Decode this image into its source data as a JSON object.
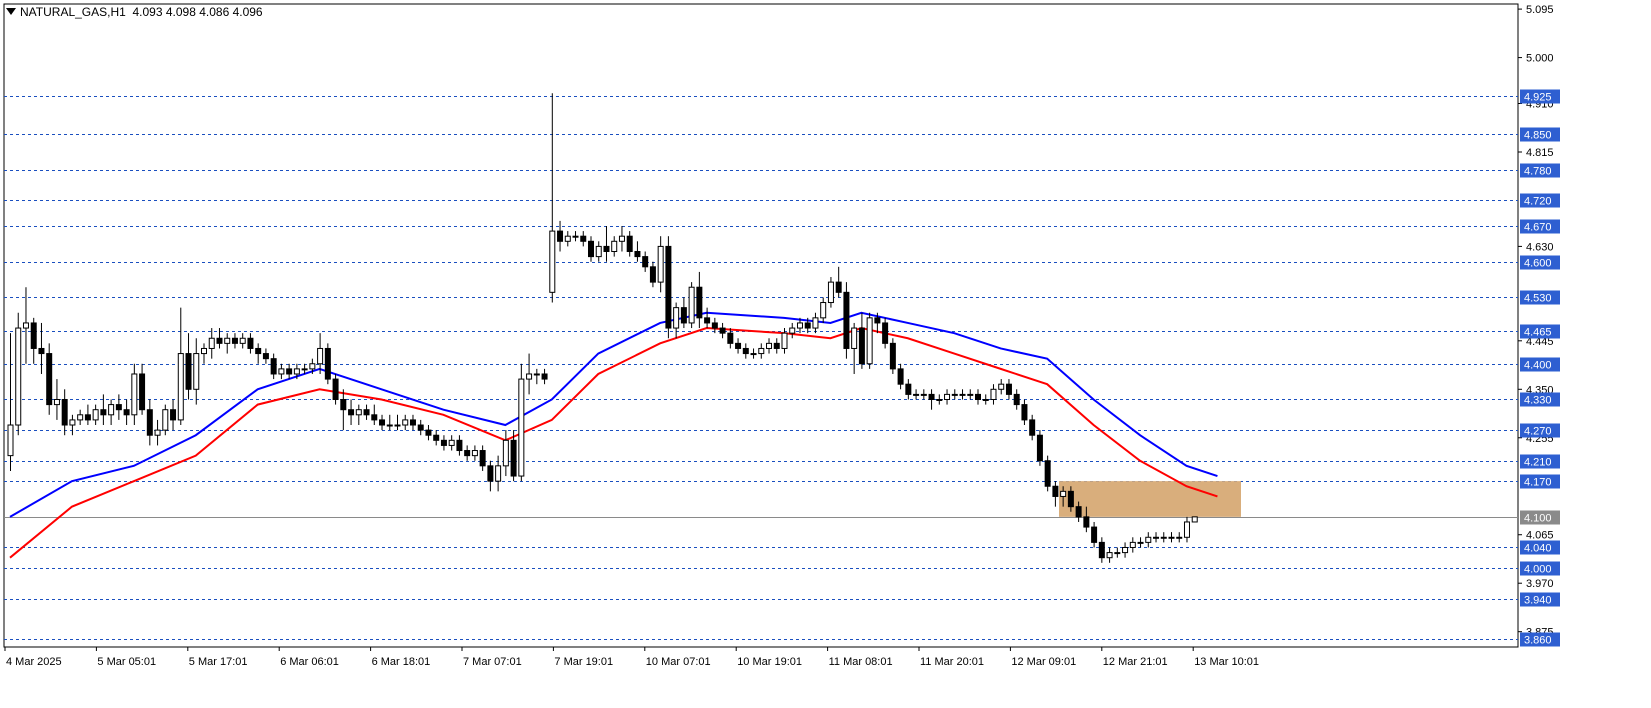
{
  "header": {
    "symbol_label": "NATURAL_GAS,H1",
    "ohlc_label": "4.093 4.098 4.086 4.096"
  },
  "colors": {
    "up_candle": "#ffffff",
    "down_candle": "#000000",
    "fast_ma": "#0000ff",
    "slow_ma": "#ff0000",
    "level_line": "#1a4fbf",
    "zone_fill": "#d9ae7c",
    "price_tag_bg": "#2e5fd1"
  },
  "chart_data": {
    "type": "candlestick",
    "ylim": [
      3.845,
      5.105
    ],
    "y_axis_ticks": [
      "5.095",
      "5.000",
      "4.910",
      "4.815",
      "4.630",
      "4.445",
      "4.350",
      "4.255",
      "4.065",
      "3.970",
      "3.875"
    ],
    "level_lines": [
      "4.925",
      "4.850",
      "4.780",
      "4.720",
      "4.670",
      "4.600",
      "4.530",
      "4.465",
      "4.400",
      "4.330",
      "4.270",
      "4.210",
      "4.170",
      "4.100",
      "4.040",
      "4.000",
      "3.940",
      "3.860"
    ],
    "x_axis_labels": [
      "4 Mar 2025",
      "5 Mar 05:01",
      "5 Mar 17:01",
      "6 Mar 06:01",
      "6 Mar 18:01",
      "7 Mar 07:01",
      "7 Mar 19:01",
      "10 Mar 07:01",
      "10 Mar 19:01",
      "11 Mar 08:01",
      "11 Mar 20:01",
      "12 Mar 09:01",
      "12 Mar 21:01",
      "13 Mar 10:01"
    ],
    "zone": {
      "low": 4.1,
      "high": 4.17
    },
    "candles": [
      [
        4.22,
        4.46,
        4.19,
        4.28
      ],
      [
        4.28,
        4.5,
        4.26,
        4.47
      ],
      [
        4.47,
        4.55,
        4.4,
        4.48
      ],
      [
        4.48,
        4.49,
        4.4,
        4.43
      ],
      [
        4.43,
        4.48,
        4.38,
        4.42
      ],
      [
        4.42,
        4.44,
        4.3,
        4.32
      ],
      [
        4.32,
        4.37,
        4.29,
        4.33
      ],
      [
        4.33,
        4.35,
        4.26,
        4.28
      ],
      [
        4.28,
        4.3,
        4.26,
        4.29
      ],
      [
        4.29,
        4.31,
        4.28,
        4.3
      ],
      [
        4.3,
        4.32,
        4.28,
        4.29
      ],
      [
        4.29,
        4.32,
        4.28,
        4.31
      ],
      [
        4.31,
        4.34,
        4.28,
        4.3
      ],
      [
        4.3,
        4.33,
        4.28,
        4.32
      ],
      [
        4.32,
        4.34,
        4.29,
        4.31
      ],
      [
        4.31,
        4.33,
        4.28,
        4.3
      ],
      [
        4.3,
        4.4,
        4.28,
        4.38
      ],
      [
        4.38,
        4.4,
        4.3,
        4.31
      ],
      [
        4.31,
        4.33,
        4.24,
        4.26
      ],
      [
        4.26,
        4.29,
        4.24,
        4.27
      ],
      [
        4.27,
        4.32,
        4.26,
        4.31
      ],
      [
        4.31,
        4.33,
        4.27,
        4.29
      ],
      [
        4.29,
        4.51,
        4.28,
        4.42
      ],
      [
        4.42,
        4.46,
        4.33,
        4.35
      ],
      [
        4.35,
        4.45,
        4.32,
        4.42
      ],
      [
        4.42,
        4.44,
        4.4,
        4.43
      ],
      [
        4.43,
        4.47,
        4.41,
        4.45
      ],
      [
        4.45,
        4.47,
        4.43,
        4.44
      ],
      [
        4.44,
        4.46,
        4.42,
        4.45
      ],
      [
        4.45,
        4.46,
        4.43,
        4.44
      ],
      [
        4.44,
        4.46,
        4.43,
        4.45
      ],
      [
        4.45,
        4.46,
        4.42,
        4.43
      ],
      [
        4.43,
        4.44,
        4.4,
        4.42
      ],
      [
        4.42,
        4.43,
        4.4,
        4.41
      ],
      [
        4.41,
        4.42,
        4.37,
        4.38
      ],
      [
        4.38,
        4.4,
        4.37,
        4.39
      ],
      [
        4.39,
        4.4,
        4.37,
        4.38
      ],
      [
        4.38,
        4.4,
        4.37,
        4.39
      ],
      [
        4.39,
        4.4,
        4.38,
        4.39
      ],
      [
        4.39,
        4.41,
        4.38,
        4.4
      ],
      [
        4.4,
        4.46,
        4.38,
        4.43
      ],
      [
        4.43,
        4.44,
        4.36,
        4.37
      ],
      [
        4.37,
        4.38,
        4.32,
        4.33
      ],
      [
        4.33,
        4.35,
        4.27,
        4.31
      ],
      [
        4.31,
        4.33,
        4.28,
        4.3
      ],
      [
        4.3,
        4.32,
        4.28,
        4.31
      ],
      [
        4.31,
        4.32,
        4.29,
        4.3
      ],
      [
        4.3,
        4.32,
        4.28,
        4.29
      ],
      [
        4.29,
        4.3,
        4.27,
        4.28
      ],
      [
        4.28,
        4.3,
        4.27,
        4.28
      ],
      [
        4.28,
        4.3,
        4.27,
        4.28
      ],
      [
        4.28,
        4.3,
        4.27,
        4.29
      ],
      [
        4.29,
        4.3,
        4.27,
        4.28
      ],
      [
        4.28,
        4.29,
        4.26,
        4.27
      ],
      [
        4.27,
        4.28,
        4.25,
        4.26
      ],
      [
        4.26,
        4.27,
        4.24,
        4.25
      ],
      [
        4.25,
        4.26,
        4.23,
        4.24
      ],
      [
        4.24,
        4.26,
        4.23,
        4.25
      ],
      [
        4.25,
        4.26,
        4.22,
        4.23
      ],
      [
        4.23,
        4.24,
        4.21,
        4.22
      ],
      [
        4.22,
        4.24,
        4.21,
        4.23
      ],
      [
        4.23,
        4.24,
        4.19,
        4.2
      ],
      [
        4.2,
        4.21,
        4.15,
        4.17
      ],
      [
        4.17,
        4.22,
        4.15,
        4.2
      ],
      [
        4.2,
        4.27,
        4.18,
        4.25
      ],
      [
        4.25,
        4.27,
        4.17,
        4.18
      ],
      [
        4.18,
        4.4,
        4.17,
        4.37
      ],
      [
        4.37,
        4.42,
        4.34,
        4.38
      ],
      [
        4.38,
        4.39,
        4.36,
        4.38
      ],
      [
        4.38,
        4.39,
        4.36,
        4.37
      ],
      [
        4.54,
        4.93,
        4.52,
        4.66
      ],
      [
        4.66,
        4.68,
        4.62,
        4.64
      ],
      [
        4.64,
        4.66,
        4.63,
        4.65
      ],
      [
        4.65,
        4.66,
        4.64,
        4.65
      ],
      [
        4.65,
        4.66,
        4.63,
        4.64
      ],
      [
        4.64,
        4.65,
        4.6,
        4.61
      ],
      [
        4.61,
        4.64,
        4.6,
        4.63
      ],
      [
        4.63,
        4.67,
        4.6,
        4.62
      ],
      [
        4.62,
        4.65,
        4.61,
        4.64
      ],
      [
        4.64,
        4.67,
        4.62,
        4.65
      ],
      [
        4.65,
        4.66,
        4.61,
        4.62
      ],
      [
        4.62,
        4.64,
        4.6,
        4.61
      ],
      [
        4.61,
        4.62,
        4.58,
        4.59
      ],
      [
        4.59,
        4.6,
        4.55,
        4.56
      ],
      [
        4.56,
        4.65,
        4.54,
        4.63
      ],
      [
        4.63,
        4.65,
        4.45,
        4.47
      ],
      [
        4.47,
        4.52,
        4.45,
        4.51
      ],
      [
        4.51,
        4.53,
        4.47,
        4.48
      ],
      [
        4.48,
        4.56,
        4.47,
        4.55
      ],
      [
        4.55,
        4.58,
        4.47,
        4.49
      ],
      [
        4.49,
        4.51,
        4.47,
        4.48
      ],
      [
        4.48,
        4.49,
        4.46,
        4.47
      ],
      [
        4.47,
        4.48,
        4.45,
        4.46
      ],
      [
        4.46,
        4.47,
        4.43,
        4.44
      ],
      [
        4.44,
        4.45,
        4.42,
        4.43
      ],
      [
        4.43,
        4.44,
        4.41,
        4.42
      ],
      [
        4.42,
        4.43,
        4.41,
        4.42
      ],
      [
        4.42,
        4.44,
        4.41,
        4.43
      ],
      [
        4.43,
        4.45,
        4.42,
        4.44
      ],
      [
        4.44,
        4.45,
        4.42,
        4.43
      ],
      [
        4.43,
        4.47,
        4.42,
        4.46
      ],
      [
        4.46,
        4.48,
        4.45,
        4.47
      ],
      [
        4.47,
        4.49,
        4.46,
        4.48
      ],
      [
        4.48,
        4.49,
        4.46,
        4.47
      ],
      [
        4.47,
        4.5,
        4.46,
        4.49
      ],
      [
        4.49,
        4.53,
        4.48,
        4.52
      ],
      [
        4.52,
        4.57,
        4.51,
        4.56
      ],
      [
        4.56,
        4.59,
        4.53,
        4.54
      ],
      [
        4.54,
        4.56,
        4.41,
        4.43
      ],
      [
        4.43,
        4.48,
        4.38,
        4.47
      ],
      [
        4.47,
        4.5,
        4.39,
        4.4
      ],
      [
        4.4,
        4.5,
        4.39,
        4.49
      ],
      [
        4.49,
        4.5,
        4.46,
        4.48
      ],
      [
        4.48,
        4.49,
        4.43,
        4.44
      ],
      [
        4.44,
        4.45,
        4.38,
        4.39
      ],
      [
        4.39,
        4.4,
        4.35,
        4.36
      ],
      [
        4.36,
        4.37,
        4.33,
        4.34
      ],
      [
        4.34,
        4.35,
        4.33,
        4.34
      ],
      [
        4.34,
        4.35,
        4.33,
        4.34
      ],
      [
        4.34,
        4.35,
        4.31,
        4.33
      ],
      [
        4.33,
        4.34,
        4.32,
        4.33
      ],
      [
        4.33,
        4.35,
        4.32,
        4.34
      ],
      [
        4.34,
        4.35,
        4.33,
        4.34
      ],
      [
        4.34,
        4.35,
        4.33,
        4.34
      ],
      [
        4.34,
        4.35,
        4.33,
        4.34
      ],
      [
        4.34,
        4.35,
        4.32,
        4.33
      ],
      [
        4.33,
        4.34,
        4.32,
        4.33
      ],
      [
        4.33,
        4.36,
        4.32,
        4.35
      ],
      [
        4.35,
        4.37,
        4.34,
        4.36
      ],
      [
        4.36,
        4.37,
        4.33,
        4.34
      ],
      [
        4.34,
        4.35,
        4.31,
        4.32
      ],
      [
        4.32,
        4.33,
        4.28,
        4.29
      ],
      [
        4.29,
        4.3,
        4.25,
        4.26
      ],
      [
        4.26,
        4.27,
        4.2,
        4.21
      ],
      [
        4.21,
        4.22,
        4.15,
        4.16
      ],
      [
        4.16,
        4.17,
        4.12,
        4.14
      ],
      [
        4.14,
        4.16,
        4.12,
        4.15
      ],
      [
        4.15,
        4.16,
        4.11,
        4.12
      ],
      [
        4.12,
        4.13,
        4.09,
        4.1
      ],
      [
        4.1,
        4.12,
        4.07,
        4.08
      ],
      [
        4.08,
        4.09,
        4.04,
        4.05
      ],
      [
        4.05,
        4.06,
        4.01,
        4.02
      ],
      [
        4.02,
        4.04,
        4.01,
        4.03
      ],
      [
        4.03,
        4.04,
        4.02,
        4.03
      ],
      [
        4.03,
        4.05,
        4.02,
        4.04
      ],
      [
        4.04,
        4.06,
        4.03,
        4.05
      ],
      [
        4.05,
        4.06,
        4.04,
        4.05
      ],
      [
        4.05,
        4.07,
        4.04,
        4.06
      ],
      [
        4.06,
        4.07,
        4.05,
        4.06
      ],
      [
        4.06,
        4.07,
        4.05,
        4.06
      ],
      [
        4.06,
        4.07,
        4.05,
        4.06
      ],
      [
        4.06,
        4.07,
        4.05,
        4.06
      ],
      [
        4.06,
        4.1,
        4.05,
        4.09
      ],
      [
        4.09,
        4.1,
        4.09,
        4.1
      ]
    ],
    "fast_ma": [
      [
        0,
        4.1
      ],
      [
        8,
        4.17
      ],
      [
        16,
        4.2
      ],
      [
        24,
        4.26
      ],
      [
        32,
        4.35
      ],
      [
        40,
        4.39
      ],
      [
        48,
        4.35
      ],
      [
        56,
        4.31
      ],
      [
        64,
        4.28
      ],
      [
        70,
        4.33
      ],
      [
        76,
        4.42
      ],
      [
        84,
        4.48
      ],
      [
        90,
        4.5
      ],
      [
        100,
        4.49
      ],
      [
        106,
        4.48
      ],
      [
        110,
        4.5
      ],
      [
        116,
        4.48
      ],
      [
        122,
        4.46
      ],
      [
        128,
        4.43
      ],
      [
        134,
        4.41
      ],
      [
        140,
        4.33
      ],
      [
        146,
        4.26
      ],
      [
        152,
        4.2
      ],
      [
        156,
        4.18
      ]
    ],
    "slow_ma": [
      [
        0,
        4.02
      ],
      [
        8,
        4.12
      ],
      [
        16,
        4.17
      ],
      [
        24,
        4.22
      ],
      [
        32,
        4.32
      ],
      [
        40,
        4.35
      ],
      [
        48,
        4.33
      ],
      [
        56,
        4.3
      ],
      [
        64,
        4.25
      ],
      [
        70,
        4.29
      ],
      [
        76,
        4.38
      ],
      [
        84,
        4.44
      ],
      [
        90,
        4.47
      ],
      [
        100,
        4.46
      ],
      [
        106,
        4.45
      ],
      [
        110,
        4.47
      ],
      [
        116,
        4.45
      ],
      [
        122,
        4.42
      ],
      [
        128,
        4.39
      ],
      [
        134,
        4.36
      ],
      [
        140,
        4.28
      ],
      [
        146,
        4.21
      ],
      [
        152,
        4.16
      ],
      [
        156,
        4.14
      ]
    ]
  }
}
